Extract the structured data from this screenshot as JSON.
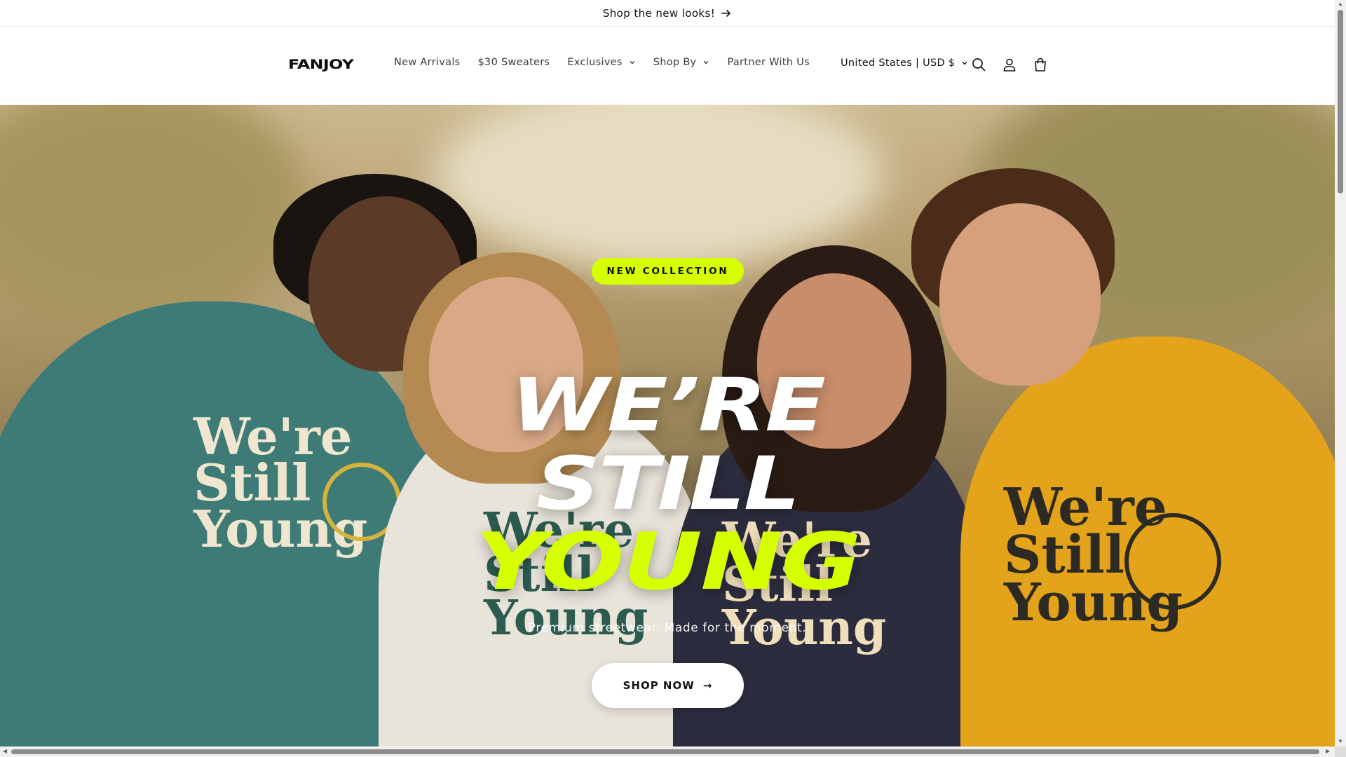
{
  "announcement": {
    "text": "Shop the new looks!",
    "icon": "arrow-right-icon"
  },
  "header": {
    "logo": "FANJOY",
    "nav": [
      {
        "label": "New Arrivals",
        "has_dropdown": false
      },
      {
        "label": "$30 Sweaters",
        "has_dropdown": false
      },
      {
        "label": "Exclusives",
        "has_dropdown": true
      },
      {
        "label": "Shop By",
        "has_dropdown": true
      },
      {
        "label": "Partner With Us",
        "has_dropdown": false
      }
    ],
    "locale": "United States | USD $",
    "icons": [
      "search-icon",
      "account-icon",
      "cart-icon"
    ]
  },
  "hero": {
    "badge": "NEW COLLECTION",
    "headline_line1": "WE’RE",
    "headline_line2": "STILL",
    "headline_line3": "YOUNG",
    "subtitle": "Premium streetwear. Made for the moment.",
    "cta_label": "SHOP NOW",
    "cta_arrow": "→",
    "sweatshirt_print": [
      "We're",
      "Still",
      "Young"
    ]
  },
  "colors": {
    "accent": "#d6ff00",
    "text": "#121212",
    "header_bg": "#ffffff",
    "sweater_teal": "#3e7b77",
    "sweater_cream": "#e9e4da",
    "sweater_navy": "#2b2d3f",
    "sweater_mustard": "#e3a31a"
  }
}
